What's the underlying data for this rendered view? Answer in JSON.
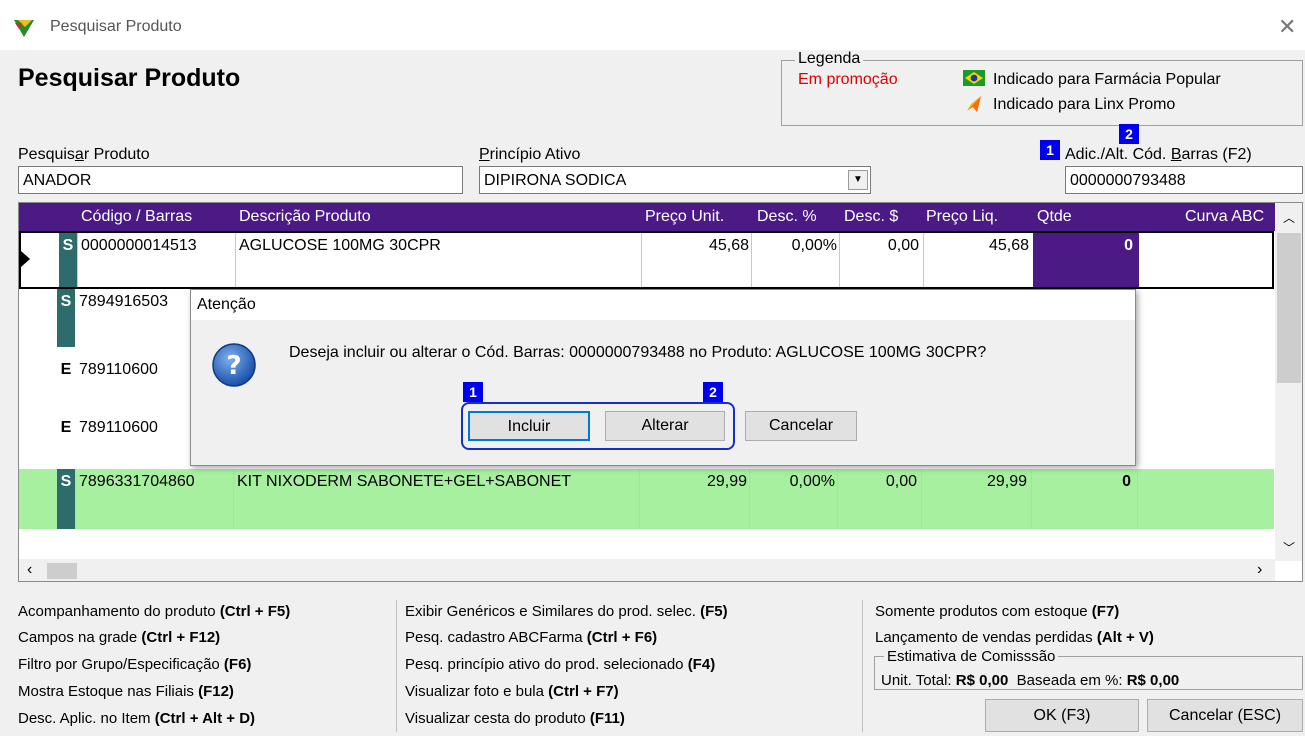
{
  "window": {
    "title": "Pesquisar Produto",
    "close_glyph": "✕"
  },
  "page_title": "Pesquisar Produto",
  "legend": {
    "label": "Legenda",
    "promo": "Em promoção",
    "farmacia_popular": "Indicado para Farmácia Popular",
    "linx_promo": "Indicado para Linx Promo",
    "promo_color": "#e00000"
  },
  "search": {
    "produto_label_pre": "Pesquis",
    "produto_label_u": "a",
    "produto_label_post": "r Produto",
    "produto_value": "ANADOR",
    "principio_label_u": "P",
    "principio_label_post": "rincípio Ativo",
    "principio_value": "DIPIRONA SODICA",
    "barras_label_pre": "Adic./Alt. Cód. ",
    "barras_label_u": "B",
    "barras_label_post": "arras (F2)",
    "barras_value": "0000000793488",
    "badge1": "1",
    "badge2": "2"
  },
  "grid": {
    "columns": [
      "Código / Barras",
      "Descrição Produto",
      "Preço Unit.",
      "Desc. %",
      "Desc. $",
      "Preço Liq.",
      "Qtde",
      "Curva ABC"
    ],
    "header_color": "#4b1a85",
    "rows": [
      {
        "flag": "S",
        "codigo": "0000000014513",
        "descricao": "AGLUCOSE 100MG 30CPR",
        "preco": "45,68",
        "desc_pct": "0,00%",
        "desc_val": "0,00",
        "preco_liq": "45,68",
        "qtde": "0"
      },
      {
        "flag": "S",
        "codigo": "7894916503",
        "descricao": "",
        "preco": "",
        "desc_pct": "",
        "desc_val": "",
        "preco_liq": "",
        "qtde": ""
      },
      {
        "flag": "E",
        "codigo": "789110600",
        "descricao": "",
        "preco": "",
        "desc_pct": "",
        "desc_val": "",
        "preco_liq": "",
        "qtde": ""
      },
      {
        "flag": "E",
        "codigo": "789110600",
        "descricao": "",
        "preco": "",
        "desc_pct": "",
        "desc_val": "",
        "preco_liq": "",
        "qtde": ""
      },
      {
        "flag": "S",
        "codigo": "7896331704860",
        "descricao": "KIT NIXODERM SABONETE+GEL+SABONET",
        "preco": "29,99",
        "desc_pct": "0,00%",
        "desc_val": "0,00",
        "preco_liq": "29,99",
        "qtde": "0"
      }
    ],
    "promo_row_color": "#a6f0a0"
  },
  "dialog": {
    "title": "Atenção",
    "message": "Deseja incluir ou alterar o Cód. Barras: 0000000793488 no Produto: AGLUCOSE 100MG 30CPR?",
    "incluir": "Incluir",
    "alterar": "Alterar",
    "cancelar": "Cancelar",
    "badge1": "1",
    "badge2": "2",
    "icon": "question-icon"
  },
  "shortcuts": {
    "col1": [
      {
        "text": "Acompanhamento do produto ",
        "key": "(Ctrl + F5)"
      },
      {
        "text": "Campos na grade ",
        "key": "(Ctrl + F12)"
      },
      {
        "text": "Filtro por Grupo/Especificação ",
        "key": "(F6)"
      },
      {
        "text": "Mostra Estoque nas Filiais ",
        "key": "(F12)"
      },
      {
        "text": "Desc. Aplic. no Item ",
        "key": "(Ctrl + Alt + D)"
      }
    ],
    "col2": [
      {
        "text": "Exibir Genéricos e Similares do prod. selec. ",
        "key": "(F5)"
      },
      {
        "text": "Pesq. cadastro ABCFarma ",
        "key": "(Ctrl + F6)"
      },
      {
        "text": "Pesq. princípio ativo do prod. selecionado ",
        "key": "(F4)"
      },
      {
        "text": "Visualizar foto e bula ",
        "key": "(Ctrl + F7)"
      },
      {
        "text": "Visualizar cesta do produto ",
        "key": "(F11)"
      }
    ],
    "col3": [
      {
        "text": "Somente produtos com estoque ",
        "key": "(F7)"
      },
      {
        "text": "Lançamento de vendas perdidas ",
        "key": "(Alt + V)"
      }
    ]
  },
  "comissao": {
    "label": "Estimativa de Comisssão",
    "unit_label": "Unit. Total: ",
    "unit_value": "R$ 0,00",
    "base_label": "Baseada em %: ",
    "base_value": "R$ 0,00"
  },
  "buttons": {
    "ok": "OK (F3)",
    "cancel": "Cancelar (ESC)"
  }
}
